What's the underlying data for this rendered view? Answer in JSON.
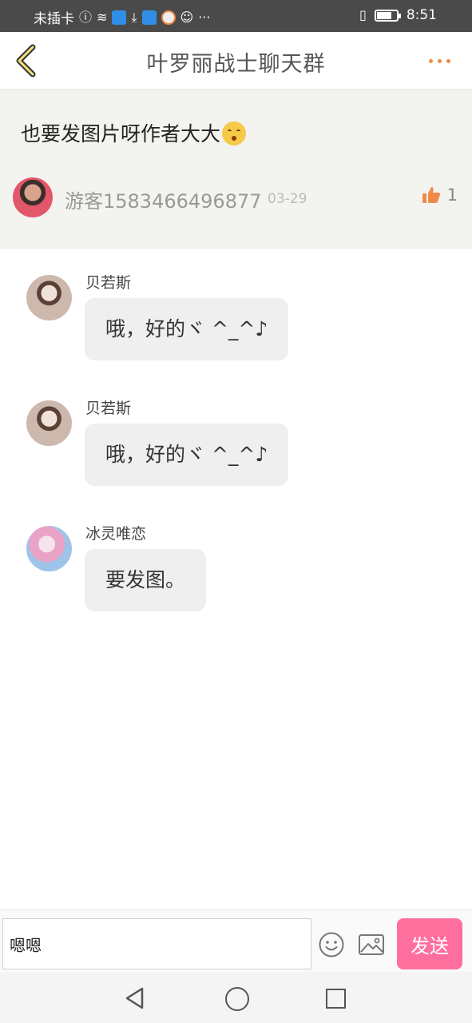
{
  "status_bar": {
    "carrier": "未插卡",
    "time": "8:51",
    "icons": [
      "sim-alert-icon",
      "wifi-icon",
      "app-icon",
      "download-icon",
      "app-icon",
      "browser-icon",
      "notification-icon",
      "more-notifications-icon",
      "vibrate-icon",
      "battery-icon"
    ],
    "overflow": "···"
  },
  "header": {
    "title": "叶罗丽战士聊天群",
    "back_icon": "chevron-left-icon",
    "more_icon": "more-dots-icon",
    "accent_color": "#f08a4b"
  },
  "post": {
    "text": "也要发图片呀作者大大",
    "emoji": "kissing-face-emoji",
    "author": "游客1583466496877",
    "date": "03-29",
    "likes": "1",
    "like_icon": "thumbs-up-icon"
  },
  "messages": [
    {
      "name": "贝若斯",
      "text": "哦，好的ヾ ^_^♪"
    },
    {
      "name": "贝若斯",
      "text": "哦，好的ヾ ^_^♪"
    },
    {
      "name": "冰灵唯恋",
      "text": "要发图。"
    }
  ],
  "input_bar": {
    "value": "嗯嗯",
    "send_label": "发送",
    "send_color": "#ff6f9e",
    "emoji_icon": "smiley-icon",
    "image_icon": "image-icon"
  },
  "nav_bar": {
    "icons": [
      "nav-back-icon",
      "nav-home-icon",
      "nav-recents-icon"
    ]
  }
}
